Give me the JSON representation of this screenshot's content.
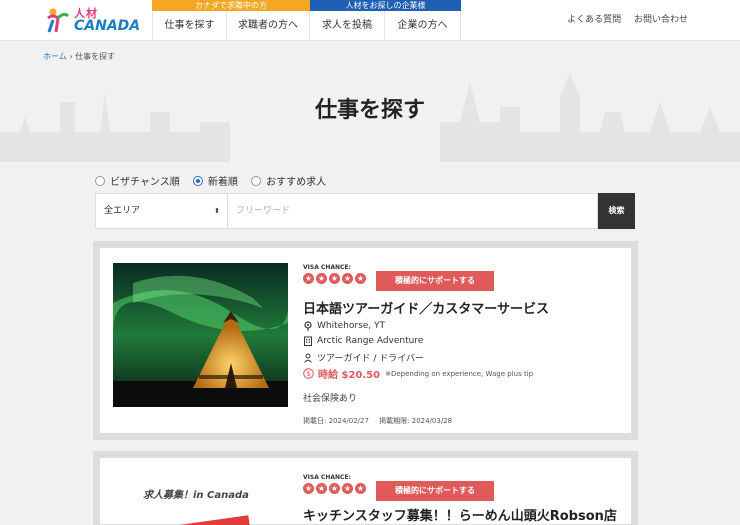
{
  "header": {
    "logo_jp": "人材",
    "logo_en": "CANADA",
    "band_seekers": "カナダで求職中の方",
    "band_employers": "人材をお探しの企業様",
    "nav": [
      "仕事を探す",
      "求職者の方へ",
      "求人を投稿",
      "企業の方へ"
    ],
    "links": [
      "よくある質問",
      "お問い合わせ"
    ]
  },
  "breadcrumb": {
    "home": "ホーム",
    "sep": "›",
    "current": "仕事を探す"
  },
  "page_title": "仕事を探す",
  "sort": {
    "options": [
      "ビザチャンス順",
      "新着順",
      "おすすめ求人"
    ],
    "selected": "新着順"
  },
  "search": {
    "area": "全エリア",
    "placeholder": "フリーワード",
    "button": "検索"
  },
  "jobs": [
    {
      "visa_label": "VISA CHANCE:",
      "stars": 5,
      "badge": "積極的にサポートする",
      "title": "日本語ツアーガイド／カスタマーサービス",
      "location": "Whitehorse, YT",
      "company": "Arctic Range Adventure",
      "category": "ツアーガイド / ドライバー",
      "wage": "時給 $20.50",
      "wage_note": "※Depending on experience, Wage plus tip",
      "benefit": "社会保険あり",
      "posted": "掲載日: 2024/02/27",
      "expires": "掲載期限: 2024/03/28"
    },
    {
      "visa_label": "VISA CHANCE:",
      "stars": 5,
      "badge": "積極的にサポートする",
      "title": "キッチンスタッフ募集！！らーめん山頭火Robson店",
      "promo": "求人募集！in Canada"
    }
  ],
  "colors": {
    "accent_red": "#e05a5a",
    "link_blue": "#2a6db5",
    "band_orange": "#f5a623",
    "band_blue": "#1f5fb4"
  }
}
